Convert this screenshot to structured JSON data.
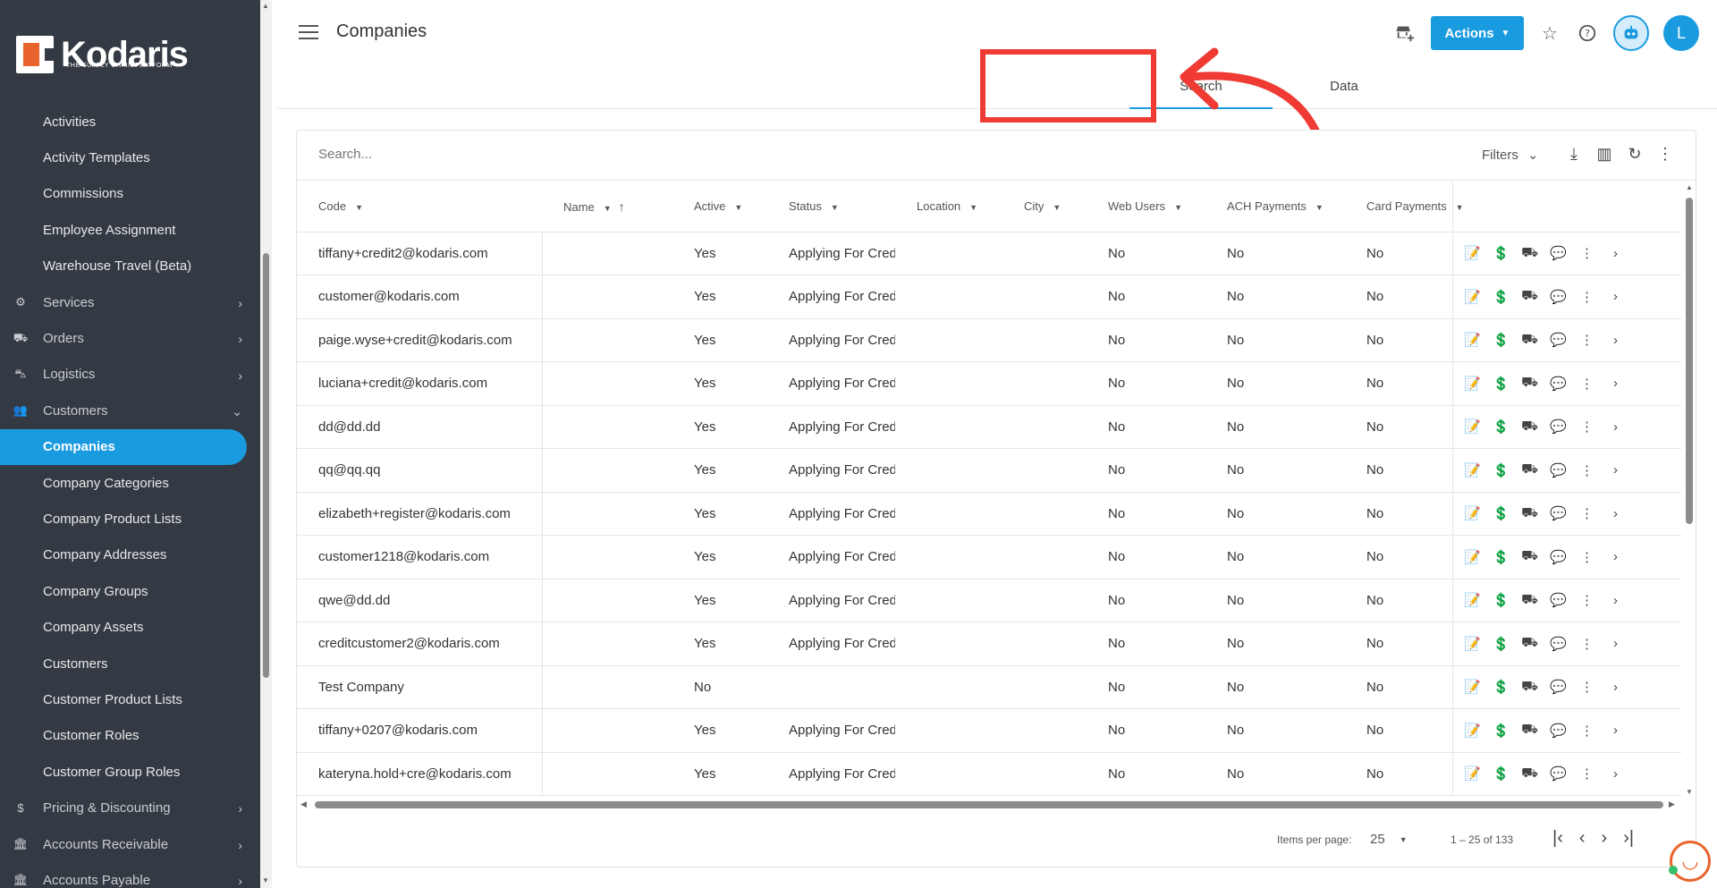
{
  "brand": {
    "name": "Kodaris",
    "tagline": "THE SUPPLY CHAIN PLATFORM",
    "accent": "#1a9be0",
    "logo_orange": "#e8642c"
  },
  "sidebar": {
    "items": [
      {
        "label": "Activities",
        "type": "sub"
      },
      {
        "label": "Activity Templates",
        "type": "sub"
      },
      {
        "label": "Commissions",
        "type": "sub"
      },
      {
        "label": "Employee Assignment",
        "type": "sub"
      },
      {
        "label": "Warehouse Travel (Beta)",
        "type": "sub"
      },
      {
        "label": "Services",
        "type": "group",
        "icon": "gears-icon",
        "glyph": "⚙",
        "chevron": "›"
      },
      {
        "label": "Orders",
        "type": "group",
        "icon": "truck-icon",
        "glyph": "⛟",
        "chevron": "›"
      },
      {
        "label": "Logistics",
        "type": "group",
        "icon": "forklift-icon",
        "glyph": "⛍",
        "chevron": "›"
      },
      {
        "label": "Customers",
        "type": "group",
        "icon": "people-icon",
        "glyph": "👥",
        "chevron": "⌄"
      },
      {
        "label": "Companies",
        "type": "sub",
        "active": true
      },
      {
        "label": "Company Categories",
        "type": "sub"
      },
      {
        "label": "Company Product Lists",
        "type": "sub"
      },
      {
        "label": "Company Addresses",
        "type": "sub"
      },
      {
        "label": "Company Groups",
        "type": "sub"
      },
      {
        "label": "Company Assets",
        "type": "sub"
      },
      {
        "label": "Customers",
        "type": "sub"
      },
      {
        "label": "Customer Product Lists",
        "type": "sub"
      },
      {
        "label": "Customer Roles",
        "type": "sub"
      },
      {
        "label": "Customer Group Roles",
        "type": "sub"
      },
      {
        "label": "Pricing & Discounting",
        "type": "group",
        "icon": "dollar-icon",
        "glyph": "$",
        "chevron": "›"
      },
      {
        "label": "Accounts Receivable",
        "type": "group",
        "icon": "bank-icon",
        "glyph": "🏛",
        "chevron": "›"
      },
      {
        "label": "Accounts Payable",
        "type": "group",
        "icon": "bank-icon",
        "glyph": "🏛",
        "chevron": "›"
      }
    ]
  },
  "header": {
    "title": "Companies",
    "actions_label": "Actions",
    "avatar_initial": "L"
  },
  "tabs": [
    {
      "label": "Search",
      "active": true
    },
    {
      "label": "Data",
      "active": false
    }
  ],
  "search": {
    "placeholder": "Search...",
    "filters_label": "Filters"
  },
  "table": {
    "columns": [
      "Code",
      "Name",
      "Active",
      "Status",
      "Location",
      "City",
      "Web Users",
      "ACH Payments",
      "Card Payments"
    ],
    "rows": [
      {
        "code": "tiffany+credit2@kodaris.com",
        "name": "",
        "active": "Yes",
        "status": "Applying For Credit",
        "location": "",
        "city": "",
        "web_users": "No",
        "ach": "No",
        "card": "No"
      },
      {
        "code": "customer@kodaris.com",
        "name": "",
        "active": "Yes",
        "status": "Applying For Credit",
        "location": "",
        "city": "",
        "web_users": "No",
        "ach": "No",
        "card": "No"
      },
      {
        "code": "paige.wyse+credit@kodaris.com",
        "name": "",
        "active": "Yes",
        "status": "Applying For Credit",
        "location": "",
        "city": "",
        "web_users": "No",
        "ach": "No",
        "card": "No"
      },
      {
        "code": "luciana+credit@kodaris.com",
        "name": "",
        "active": "Yes",
        "status": "Applying For Credit",
        "location": "",
        "city": "",
        "web_users": "No",
        "ach": "No",
        "card": "No"
      },
      {
        "code": "dd@dd.dd",
        "name": "",
        "active": "Yes",
        "status": "Applying For Credit",
        "location": "",
        "city": "",
        "web_users": "No",
        "ach": "No",
        "card": "No"
      },
      {
        "code": "qq@qq.qq",
        "name": "",
        "active": "Yes",
        "status": "Applying For Credit",
        "location": "",
        "city": "",
        "web_users": "No",
        "ach": "No",
        "card": "No"
      },
      {
        "code": "elizabeth+register@kodaris.com",
        "name": "",
        "active": "Yes",
        "status": "Applying For Credit",
        "location": "",
        "city": "",
        "web_users": "No",
        "ach": "No",
        "card": "No"
      },
      {
        "code": "customer1218@kodaris.com",
        "name": "",
        "active": "Yes",
        "status": "Applying For Credit",
        "location": "",
        "city": "",
        "web_users": "No",
        "ach": "No",
        "card": "No"
      },
      {
        "code": "qwe@dd.dd",
        "name": "",
        "active": "Yes",
        "status": "Applying For Credit",
        "location": "",
        "city": "",
        "web_users": "No",
        "ach": "No",
        "card": "No"
      },
      {
        "code": "creditcustomer2@kodaris.com",
        "name": "",
        "active": "Yes",
        "status": "Applying For Credit",
        "location": "",
        "city": "",
        "web_users": "No",
        "ach": "No",
        "card": "No"
      },
      {
        "code": "Test Company",
        "name": "",
        "active": "No",
        "status": "",
        "location": "",
        "city": "",
        "web_users": "No",
        "ach": "No",
        "card": "No"
      },
      {
        "code": "tiffany+0207@kodaris.com",
        "name": "",
        "active": "Yes",
        "status": "Applying For Credit",
        "location": "",
        "city": "",
        "web_users": "No",
        "ach": "No",
        "card": "No"
      },
      {
        "code": "kateryna.hold+cre@kodaris.com",
        "name": "",
        "active": "Yes",
        "status": "Applying For Credit",
        "location": "",
        "city": "",
        "web_users": "No",
        "ach": "No",
        "card": "No"
      }
    ]
  },
  "paginator": {
    "items_label": "Items per page:",
    "page_size": "25",
    "range": "1 – 25 of 133"
  },
  "annotation_color": "#ef3b33"
}
